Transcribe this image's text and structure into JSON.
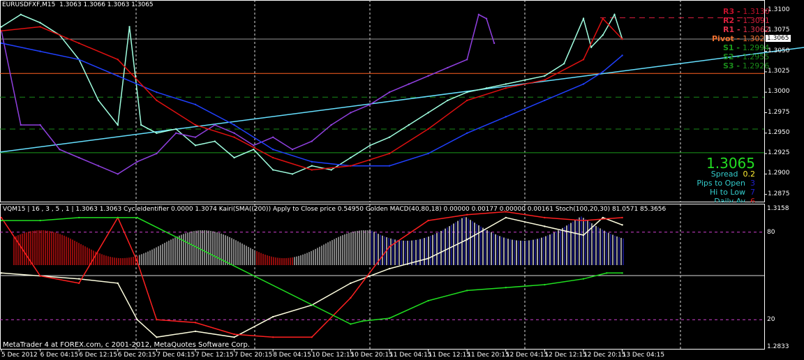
{
  "header": {
    "symbol_tf": "EURUSDFXF,M15",
    "ohlc": "1.3063 1.3066 1.3063 1.3065"
  },
  "pivots": [
    {
      "label": "R3",
      "value": "1.3130",
      "color": "#c0102a",
      "price": 1.313
    },
    {
      "label": "R2",
      "value": "1.3091",
      "color": "#d81e3c",
      "price": 1.3091
    },
    {
      "label": "R1",
      "value": "1.3062",
      "color": "#e0304a",
      "price": 1.3062
    },
    {
      "label": "Pivot",
      "value": "1.3023",
      "color": "#f07030",
      "price": 1.3023
    },
    {
      "label": "S1",
      "value": "1.2994",
      "color": "#1a9a1a",
      "price": 1.2994
    },
    {
      "label": "S2",
      "value": "1.2955",
      "color": "#1a8a1a",
      "price": 1.2955
    },
    {
      "label": "S3",
      "value": "1.2926",
      "color": "#1a8a1a",
      "price": 1.2926
    }
  ],
  "info": {
    "price": "1.3065",
    "spread_label": "Spread",
    "spread": "0.2",
    "pips_label": "Pips to Open",
    "pips": "3",
    "hilo_label": "Hi to Low",
    "hilo": "7",
    "daily_label": "Daily Av",
    "daily": "6"
  },
  "indicator": {
    "title": "VQM15 | 16 , 3 , 5 , 1 | 1.3063 1.3063 CycleIdentifier 0.0000 1.3074 Kairi(SMA((200)) Apply to Close price 0.54950 Golden MACD(40,80,18) 0.00000 0.00177 0.00000 0.00161 Stoch(100,20,30) 81.0571 85.3656",
    "scale_top": "1.3158",
    "scale_80": "80",
    "scale_20": "20",
    "scale_bottom": "1.2833"
  },
  "footer": "MetaTrader 4 at FOREX.com, c 2001-2012, MetaQuotes Software Corp.",
  "chart_data": {
    "type": "line",
    "title": "EURUSDFXF,M15",
    "x_ticks": [
      "5 Dec 2012",
      "6 Dec 04:15",
      "6 Dec 12:15",
      "6 Dec 20:15",
      "7 Dec 04:15",
      "7 Dec 12:15",
      "7 Dec 20:15",
      "8 Dec 04:15",
      "10 Dec 12:15",
      "10 Dec 20:15",
      "11 Dec 04:15",
      "11 Dec 12:15",
      "11 Dec 20:15",
      "12 Dec 04:15",
      "12 Dec 12:15",
      "12 Dec 20:15",
      "13 Dec 04:15"
    ],
    "y_ticks": [
      "1.3100",
      "1.3075",
      "1.3050",
      "1.3025",
      "1.3000",
      "1.2975",
      "1.2950",
      "1.2925",
      "1.2900",
      "1.2875"
    ],
    "current_price_label": "1.3065",
    "ylim": [
      1.2862,
      1.3113
    ],
    "series": [
      {
        "name": "close",
        "color": "#a0ffe0",
        "x": [
          0,
          0.5,
          1,
          1.5,
          2,
          2.5,
          3,
          3.3,
          3.6,
          4,
          4.5,
          5,
          5.5,
          6,
          6.5,
          7,
          7.5,
          8,
          8.5,
          9,
          9.5,
          10,
          10.5,
          11,
          11.5,
          12,
          12.5,
          13,
          13.5,
          14,
          14.5,
          15,
          15.2,
          15.5,
          15.8,
          16
        ],
        "y": [
          1.308,
          1.3095,
          1.3085,
          1.307,
          1.304,
          1.299,
          1.296,
          1.308,
          1.296,
          1.295,
          1.2955,
          1.2935,
          1.294,
          1.292,
          1.293,
          1.2905,
          1.29,
          1.291,
          1.2905,
          1.292,
          1.2935,
          1.2945,
          1.296,
          1.2975,
          1.299,
          1.3,
          1.3005,
          1.301,
          1.3015,
          1.302,
          1.3035,
          1.309,
          1.3055,
          1.307,
          1.3095,
          1.3065
        ]
      },
      {
        "name": "other-symbol",
        "color": "#9040e0",
        "x": [
          0,
          0.5,
          1,
          1.5,
          2,
          2.5,
          3,
          3.5,
          4,
          4.5,
          5,
          5.5,
          6,
          6.5,
          7,
          7.5,
          8,
          8.5,
          9,
          9.5,
          10,
          10.5,
          11,
          11.5,
          12,
          12.3,
          12.5,
          12.7
        ],
        "y": [
          1.3075,
          1.296,
          1.296,
          1.293,
          1.292,
          1.291,
          1.29,
          1.2915,
          1.2925,
          1.295,
          1.2945,
          1.296,
          1.295,
          1.2935,
          1.2945,
          1.293,
          1.294,
          1.296,
          1.2975,
          1.2985,
          1.3,
          1.301,
          1.302,
          1.303,
          1.304,
          1.3095,
          1.309,
          1.306
        ]
      },
      {
        "name": "ma-blue",
        "color": "#2040ff",
        "x": [
          0,
          1,
          2,
          3,
          4,
          5,
          6,
          7,
          8,
          9,
          10,
          11,
          12,
          13,
          14,
          15,
          15.5,
          16
        ],
        "y": [
          1.306,
          1.305,
          1.304,
          1.302,
          1.3,
          1.2985,
          1.296,
          1.293,
          1.2915,
          1.291,
          1.291,
          1.2925,
          1.295,
          1.297,
          1.299,
          1.301,
          1.3025,
          1.3045
        ]
      },
      {
        "name": "ma-red",
        "color": "#e01010",
        "x": [
          0,
          1,
          2,
          3,
          4,
          5,
          6,
          7,
          8,
          9,
          10,
          11,
          12,
          13,
          14,
          15,
          15.5,
          16
        ],
        "y": [
          1.3075,
          1.308,
          1.306,
          1.304,
          1.299,
          1.296,
          1.2945,
          1.292,
          1.2905,
          1.291,
          1.2925,
          1.2955,
          1.299,
          1.3005,
          1.3015,
          1.304,
          1.309,
          1.3065
        ]
      }
    ],
    "lower_pane": {
      "ylim": [
        0,
        100
      ],
      "series": [
        {
          "name": "stoch-main",
          "color": "#ffffe0",
          "x": [
            0,
            1,
            2,
            3,
            3.5,
            4,
            5,
            6,
            7,
            8,
            9,
            10,
            11,
            12,
            13,
            14,
            15,
            15.5,
            16
          ],
          "y": [
            52,
            50,
            48,
            45,
            20,
            8,
            12,
            8,
            22,
            30,
            45,
            55,
            62,
            75,
            90,
            84,
            78,
            90,
            85
          ]
        },
        {
          "name": "stoch-signal",
          "color": "#ff2020",
          "x": [
            0,
            1,
            2,
            3,
            3.5,
            4,
            5,
            6,
            7,
            8,
            9,
            10,
            11,
            12,
            13,
            14,
            15,
            16
          ],
          "y": [
            90,
            50,
            45,
            90,
            60,
            20,
            18,
            10,
            8,
            8,
            35,
            70,
            88,
            92,
            94,
            90,
            88,
            90
          ]
        },
        {
          "name": "cycle-green",
          "color": "#20e020",
          "x": [
            0,
            1,
            2,
            3,
            3.5,
            9,
            9.3,
            10,
            11,
            12,
            13,
            14,
            15,
            15.6,
            16
          ],
          "y": [
            88,
            88,
            90,
            90,
            90,
            17,
            19,
            21,
            33,
            40,
            42,
            44,
            48,
            52,
            52
          ]
        }
      ]
    }
  }
}
